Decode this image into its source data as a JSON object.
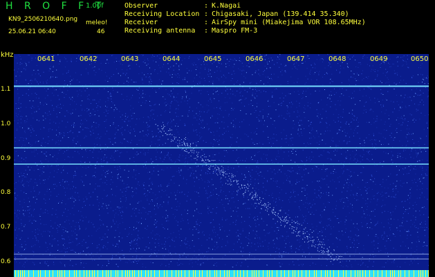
{
  "app": {
    "brand": "H R O F F T",
    "version": "1.00f"
  },
  "file": {
    "name": "KN9_2506210640.png",
    "meleo_label": "meleo!",
    "datetime": "25.06.21 06:40",
    "count": "46"
  },
  "info": [
    {
      "label": "Observer",
      "value": "K.Nagai"
    },
    {
      "label": "Receiving Location",
      "value": "Chigasaki, Japan (139.414 35.340)"
    },
    {
      "label": "Receiver",
      "value": "AirSpy mini (Miakejima VOR 108.65MHz)"
    },
    {
      "label": "Receiving antenna",
      "value": "Maspro FM-3"
    }
  ],
  "axis": {
    "y_unit": "kHz",
    "x_ticks": [
      "0641",
      "0642",
      "0643",
      "0644",
      "0645",
      "0646",
      "0647",
      "0648",
      "0649",
      "0650"
    ],
    "y_ticks": [
      "1.1",
      "1.0",
      "0.9",
      "0.8",
      "0.7",
      "0.6"
    ]
  },
  "colors": {
    "background": "#000000",
    "waterfall": "#0a1c8c",
    "text": "#ffff3c",
    "brand": "#20e040",
    "carrier": "#78e0ff"
  },
  "signals": {
    "carrier_lines_khz": [
      1.103,
      0.925,
      0.878
    ],
    "meteor_trail_khz": [
      0.99,
      0.6
    ]
  }
}
